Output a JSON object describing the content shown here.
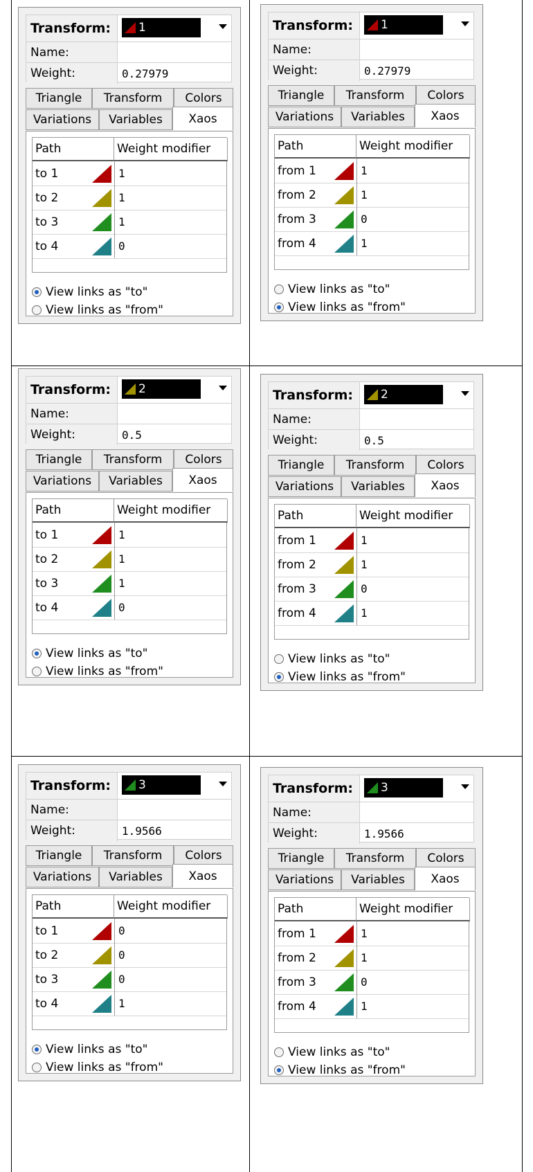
{
  "colors": {
    "t1": "#b00000",
    "t2": "#a19200",
    "t3": "#1f8e1f",
    "t4": "#1f8088"
  },
  "labels": {
    "transform": "Transform:",
    "name": "Name:",
    "weight": "Weight:",
    "col_path": "Path",
    "col_weight": "Weight modifier",
    "radio_to": "View links as \"to\"",
    "radio_from": "View links as \"from\""
  },
  "tabs": {
    "triangle": "Triangle",
    "transform": "Transform",
    "colors": "Colors",
    "variations": "Variations",
    "variables": "Variables",
    "xaos": "Xaos"
  },
  "panels": [
    {
      "transform": "1",
      "tcolor": "t1",
      "weight": "0.27979",
      "mode": "to",
      "rows": [
        {
          "path": "to 1",
          "wm": "1"
        },
        {
          "path": "to 2",
          "wm": "1"
        },
        {
          "path": "to 3",
          "wm": "1"
        },
        {
          "path": "to 4",
          "wm": "0"
        }
      ]
    },
    {
      "transform": "1",
      "tcolor": "t1",
      "weight": "0.27979",
      "mode": "from",
      "rows": [
        {
          "path": "from 1",
          "wm": "1"
        },
        {
          "path": "from 2",
          "wm": "1"
        },
        {
          "path": "from 3",
          "wm": "0"
        },
        {
          "path": "from 4",
          "wm": "1"
        }
      ]
    },
    {
      "transform": "2",
      "tcolor": "t2",
      "weight": "0.5",
      "mode": "to",
      "rows": [
        {
          "path": "to 1",
          "wm": "1"
        },
        {
          "path": "to 2",
          "wm": "1"
        },
        {
          "path": "to 3",
          "wm": "1"
        },
        {
          "path": "to 4",
          "wm": "0"
        }
      ]
    },
    {
      "transform": "2",
      "tcolor": "t2",
      "weight": "0.5",
      "mode": "from",
      "rows": [
        {
          "path": "from 1",
          "wm": "1"
        },
        {
          "path": "from 2",
          "wm": "1"
        },
        {
          "path": "from 3",
          "wm": "0"
        },
        {
          "path": "from 4",
          "wm": "1"
        }
      ]
    },
    {
      "transform": "3",
      "tcolor": "t3",
      "weight": "1.9566",
      "mode": "to",
      "rows": [
        {
          "path": "to 1",
          "wm": "0"
        },
        {
          "path": "to 2",
          "wm": "0"
        },
        {
          "path": "to 3",
          "wm": "0"
        },
        {
          "path": "to 4",
          "wm": "1"
        }
      ]
    },
    {
      "transform": "3",
      "tcolor": "t3",
      "weight": "1.9566",
      "mode": "from",
      "rows": [
        {
          "path": "from 1",
          "wm": "1"
        },
        {
          "path": "from 2",
          "wm": "1"
        },
        {
          "path": "from 3",
          "wm": "0"
        },
        {
          "path": "from 4",
          "wm": "1"
        }
      ]
    }
  ]
}
